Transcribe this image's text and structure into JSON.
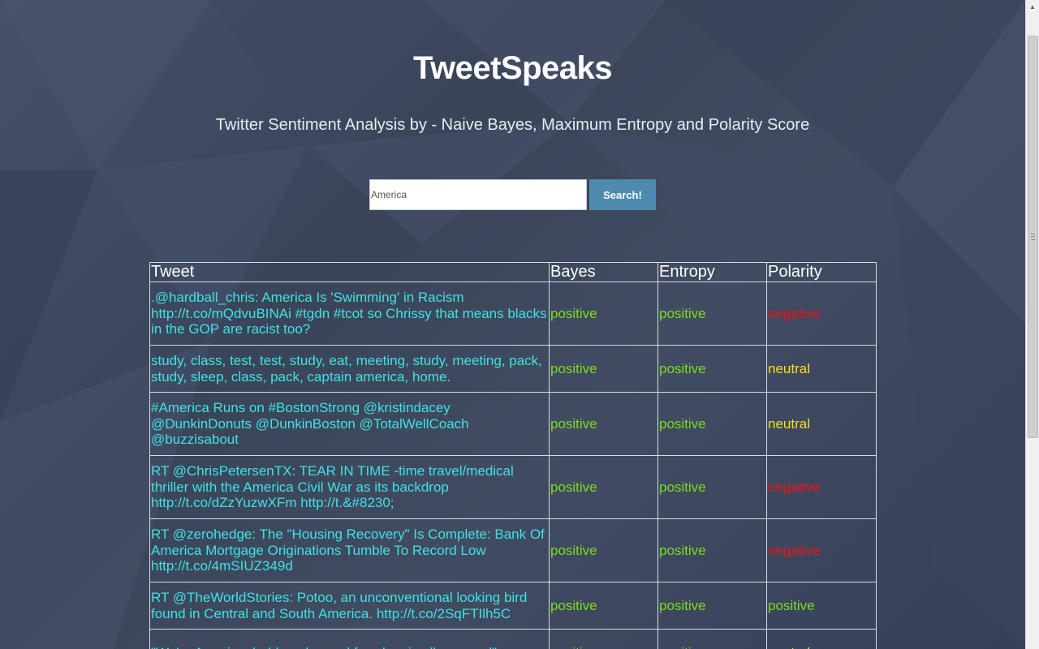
{
  "header": {
    "title": "TweetSpeaks",
    "subtitle": "Twitter Sentiment Analysis by - Naive Bayes, Maximum Entropy and Polarity Score"
  },
  "search": {
    "value": "America",
    "button_label": "Search!"
  },
  "table": {
    "columns": [
      "Tweet",
      "Bayes",
      "Entropy",
      "Polarity"
    ],
    "rows": [
      {
        "tweet": ".@hardball_chris: America Is 'Swimming' in Racism http://t.co/mQdvuBINAi #tgdn #tcot so Chrissy that means blacks in the GOP are racist too?",
        "bayes": "positive",
        "entropy": "positive",
        "polarity": "negative"
      },
      {
        "tweet": "study, class, test, test, study, eat, meeting, study, meeting, pack, study, sleep, class, pack, captain america, home.",
        "bayes": "positive",
        "entropy": "positive",
        "polarity": "neutral"
      },
      {
        "tweet": "#America Runs on #BostonStrong @kristindacey @DunkinDonuts @DunkinBoston @TotalWellCoach @buzzisabout",
        "bayes": "positive",
        "entropy": "positive",
        "polarity": "neutral"
      },
      {
        "tweet": "RT @ChrisPetersenTX: TEAR IN TIME -time travel/medical thriller with the America Civil War as its backdrop http://t.co/dZzYuzwXFm http://t.&#8230;",
        "bayes": "positive",
        "entropy": "positive",
        "polarity": "negative"
      },
      {
        "tweet": "RT @zerohedge: The \"Housing Recovery\" Is Complete: Bank Of America Mortgage Originations Tumble To Record Low http://t.co/4mSIUZ349d",
        "bayes": "positive",
        "entropy": "positive",
        "polarity": "negative"
      },
      {
        "tweet": "RT @TheWorldStories: Potoo, an unconventional looking bird found in Central and South America. http://t.co/2SqFTIlh5C",
        "bayes": "positive",
        "entropy": "positive",
        "polarity": "positive"
      },
      {
        "tweet": "\"We're America, bald eagles and freedom is all we need\"",
        "bayes": "positive",
        "entropy": "positive",
        "polarity": "neutral"
      }
    ]
  },
  "colors": {
    "background": "#3b4558",
    "tweet_text": "#3fe3e3",
    "positive": "#7bdc1f",
    "negative": "#ee1111",
    "neutral": "#f2e31a",
    "button": "#4d8aae"
  }
}
